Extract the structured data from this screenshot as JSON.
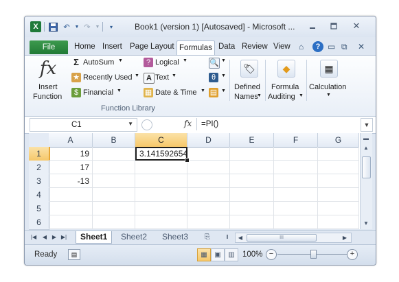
{
  "window": {
    "title": "Book1 (version 1) [Autosaved]  -  Microsoft ..."
  },
  "ribbon_tabs": [
    "File",
    "Home",
    "Insert",
    "Page Layout",
    "Formulas",
    "Data",
    "Review",
    "View"
  ],
  "active_tab": "Formulas",
  "ribbon": {
    "insert_function": {
      "line1": "Insert",
      "line2": "Function"
    },
    "autosum": "AutoSum",
    "recently_used": "Recently Used",
    "financial": "Financial",
    "logical": "Logical",
    "text": "Text",
    "date_time": "Date & Time",
    "function_library_label": "Function Library",
    "defined_names": {
      "line1": "Defined",
      "line2": "Names"
    },
    "formula_auditing": {
      "line1": "Formula",
      "line2": "Auditing"
    },
    "calculation": "Calculation"
  },
  "formula_bar": {
    "name_box": "C1",
    "formula": "=PI()"
  },
  "columns": [
    "A",
    "B",
    "C",
    "D",
    "E",
    "F",
    "G"
  ],
  "rows": [
    "1",
    "2",
    "3",
    "4",
    "5",
    "6"
  ],
  "cells": {
    "A1": "19",
    "A2": "17",
    "A3": "-13",
    "C1": "3.141592654"
  },
  "selected_cell": "C1",
  "sheets": [
    "Sheet1",
    "Sheet2",
    "Sheet3"
  ],
  "active_sheet": "Sheet1",
  "status": {
    "mode": "Ready",
    "zoom": "100%"
  },
  "colors": {
    "file_tab": "#217a36",
    "selection": "#f6c86a"
  }
}
